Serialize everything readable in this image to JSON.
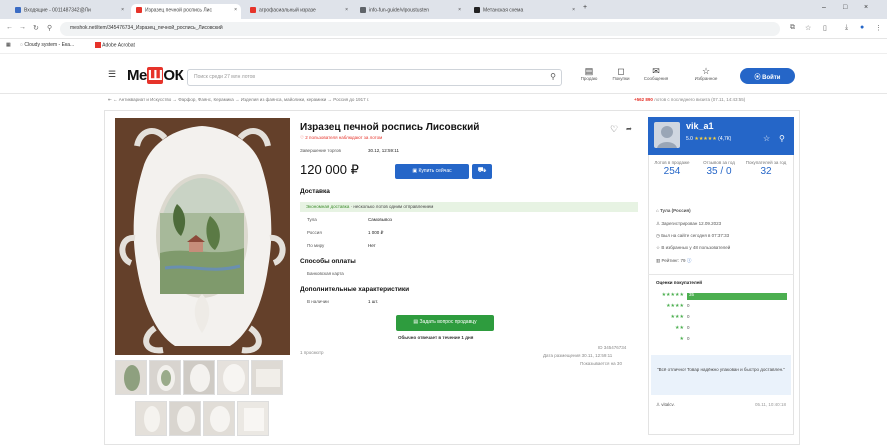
{
  "browser": {
    "tabs": [
      {
        "label": "Входящие - 0011487342@Ли",
        "color": "#3b6cc4"
      },
      {
        "label": "Изразец печной роспись Лис",
        "color": "#e6332a"
      },
      {
        "label": "агрофасиальный изразе",
        "color": "#e6332a"
      },
      {
        "label": "info-fun-guide/vlpoustusten",
        "color": "#5f6368"
      },
      {
        "label": "Метанская схема",
        "color": "#222"
      }
    ],
    "new_tab": "+",
    "controls": [
      "–",
      "□",
      "×"
    ],
    "url": "meshok.net/item/345476734_Изразец_печной_роспись_Лисовский",
    "bookmarks": [
      {
        "label": "Cloudy system - Ека..."
      },
      {
        "label": "Adobe Acrobat"
      }
    ]
  },
  "site": {
    "logo_a": "Ме",
    "logo_b": "Ш",
    "logo_c": "ОК",
    "search_placeholder": "Поиск среди 27 млн лотов",
    "header_icons": [
      {
        "icon": "history-icon",
        "glyph": "▤",
        "label": "Продаю"
      },
      {
        "icon": "bag-icon",
        "glyph": "◻",
        "label": "Покупки"
      },
      {
        "icon": "mail-icon",
        "glyph": "✉",
        "label": "Сообщения"
      },
      {
        "icon": "star-icon",
        "glyph": "☆",
        "label": "Избранное"
      }
    ],
    "login": "Войти",
    "breadcrumbs": "Антиквариат и Искусство → Фарфор, Фаянс, Керамика → Изделия из фаянса, майолики, керамики → Россия до 1917 г.",
    "promo_num": "+562 890",
    "promo_text": "лотов с последнего визита (07.11, 14:43:55)"
  },
  "lot": {
    "title": "Изразец печной роспись Лисовский",
    "watch_note": "2 пользователя наблюдают за лотом",
    "end_label": "Завершение торгов",
    "end_value": "30.12, 12:59:11",
    "price": "120 000 ₽",
    "buy_label": "Купить сейчас",
    "delivery_title": "Доставка",
    "delivery_note_a": "Экономная доставка",
    "delivery_note_b": " · несколько лотов одним отправлением",
    "delivery_rows": [
      {
        "k": "Тула",
        "v": "Самовывоз"
      },
      {
        "k": "Россия",
        "v": "1 000 ₽"
      },
      {
        "k": "По миру",
        "v": "Нет"
      }
    ],
    "payment_title": "Способы оплаты",
    "payment_value": "Банковская карта",
    "extra_title": "Дополнительные характеристики",
    "stock_key": "В наличии",
    "stock_val": "1 шт.",
    "ask_label": "Задать вопрос продавцу",
    "reply_note": "Обычно отвечает в течение 1 дня",
    "views": "1 просмотр",
    "lot_id": "ID 345476734",
    "placed": "Дата размещения 30.11, 12:59:11",
    "shown": "Показывается на 30"
  },
  "seller": {
    "name": "vik_a1",
    "rating": "5.0",
    "rating_count": "(4,7К)",
    "stats": [
      {
        "label": "Лотов в продаже",
        "value": "254",
        "color": "#2566c8"
      },
      {
        "label": "Отзывов за год",
        "value": "35 / 0",
        "color": "#2566c8"
      },
      {
        "label": "Покупателей за год",
        "value": "32",
        "color": "#2566c8"
      }
    ],
    "lines": [
      {
        "icon": "location-icon",
        "glyph": "⌂",
        "text": "Тула (Россия)"
      },
      {
        "icon": "user-icon",
        "glyph": "♙",
        "text": "Зарегистрирован 12.09.2023"
      },
      {
        "icon": "clock-icon",
        "glyph": "◷",
        "text": "Был на сайте сегодня в 07:37:33"
      },
      {
        "icon": "star-icon",
        "glyph": "☆",
        "text": "В избранных у 48 пользователей"
      },
      {
        "icon": "chart-icon",
        "glyph": "▥",
        "text": "Рейтинг: 79"
      }
    ],
    "ratings_title": "Оценки покупателей",
    "rating_rows": [
      {
        "stars": "★★★★★",
        "count": "35",
        "fill": 1.0
      },
      {
        "stars": "★★★★",
        "count": "0",
        "fill": 0
      },
      {
        "stars": "★★★",
        "count": "0",
        "fill": 0
      },
      {
        "stars": "★★",
        "count": "0",
        "fill": 0
      },
      {
        "stars": "★",
        "count": "0",
        "fill": 0
      }
    ],
    "review_text": "\"Всё отлично! Товар надёжно упакован и быстро доставлен.\"",
    "review_author": "vitalcv.",
    "review_date": "05.11, 10:40:18"
  }
}
